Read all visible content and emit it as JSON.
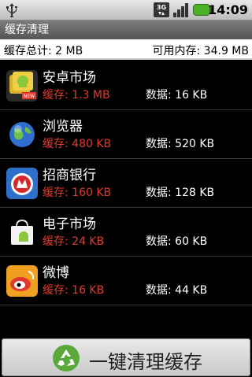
{
  "status_bar": {
    "time": "14:09",
    "network": "3G"
  },
  "title": "缓存清理",
  "summary": {
    "total_cache": "缓存总计: 2 MB",
    "free_memory": "可用内存: 34.9 MB"
  },
  "apps": [
    {
      "name": "安卓市场",
      "cache": "缓存: 1.3 MB",
      "data": "数据: 16 KB",
      "icon": "android-market-icon"
    },
    {
      "name": "浏览器",
      "cache": "缓存: 480 KB",
      "data": "数据: 520 KB",
      "icon": "browser-globe-icon"
    },
    {
      "name": "招商银行",
      "cache": "缓存: 160 KB",
      "data": "数据: 128 KB",
      "icon": "cmb-bank-icon"
    },
    {
      "name": "电子市场",
      "cache": "缓存: 24 KB",
      "data": "数据: 60 KB",
      "icon": "market-bag-icon"
    },
    {
      "name": "微博",
      "cache": "缓存: 16 KB",
      "data": "数据: 44 KB",
      "icon": "weibo-icon"
    }
  ],
  "clean_button": {
    "label": "一键清理缓存",
    "icon": "recycle-icon"
  },
  "colors": {
    "cache_text": "#e03a2f",
    "background": "#000000"
  }
}
